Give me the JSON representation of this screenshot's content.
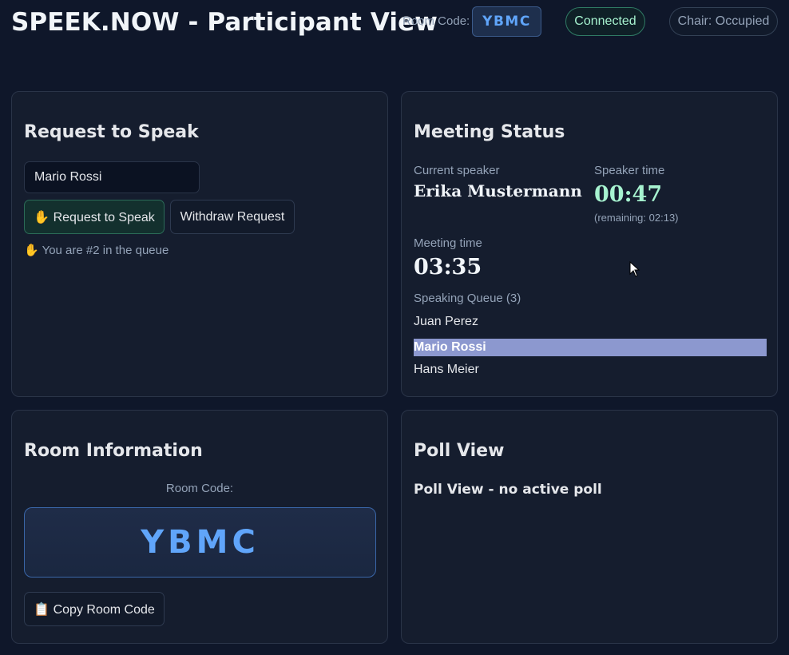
{
  "header": {
    "title": "SPEEK.NOW - Participant View",
    "room_code_label": "Room Code:",
    "room_code": "YBMC",
    "connection_status": "Connected",
    "chair_status": "Chair: Occupied"
  },
  "request_panel": {
    "title": "Request to Speak",
    "name_value": "Mario Rossi",
    "request_button": "✋ Request to Speak",
    "withdraw_button": "Withdraw Request",
    "queue_position": "✋ You are #2 in the queue"
  },
  "status_panel": {
    "title": "Meeting Status",
    "current_speaker_label": "Current speaker",
    "current_speaker": "Erika Mustermann",
    "speaker_time_label": "Speaker time",
    "speaker_time": "00:47",
    "remaining": "(remaining: 02:13)",
    "meeting_time_label": "Meeting time",
    "meeting_time": "03:35",
    "queue_label": "Speaking Queue (3)",
    "queue": [
      "Juan Perez",
      "Mario Rossi",
      "Hans Meier"
    ]
  },
  "room_panel": {
    "title": "Room Information",
    "room_code_label": "Room Code:",
    "room_code": "YBMC",
    "copy_button": "📋 Copy Room Code"
  },
  "poll_panel": {
    "title": "Poll View",
    "message": "Poll View - no active poll"
  },
  "colors": {
    "background": "#0f172a",
    "card": "#151d2e",
    "accent_blue": "#60a5fa",
    "accent_green": "#a7f3d0",
    "highlight": "#8c98cf"
  }
}
